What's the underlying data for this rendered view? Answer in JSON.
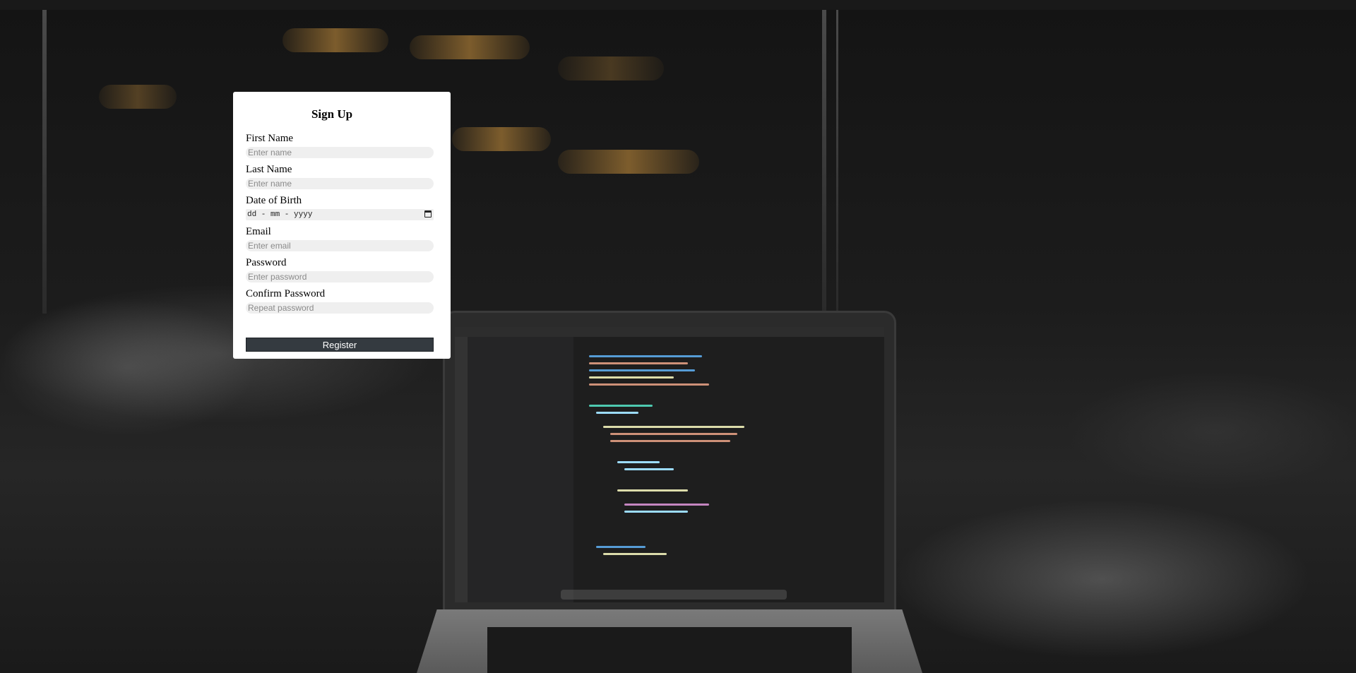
{
  "form": {
    "title": "Sign Up",
    "fields": {
      "first_name": {
        "label": "First Name",
        "placeholder": "Enter name"
      },
      "last_name": {
        "label": "Last Name",
        "placeholder": "Enter name"
      },
      "dob": {
        "label": "Date of Birth",
        "placeholder": "dd - mm - yyyy"
      },
      "email": {
        "label": "Email",
        "placeholder": "Enter email"
      },
      "password": {
        "label": "Password",
        "placeholder": "Enter password"
      },
      "confirm_password": {
        "label": "Confirm Password",
        "placeholder": "Repeat password"
      }
    },
    "submit_label": "Register"
  },
  "colors": {
    "button_bg": "#343a40",
    "input_bg": "#efefef",
    "card_bg": "#ffffff"
  },
  "icons": {
    "date_picker": "calendar-icon"
  }
}
